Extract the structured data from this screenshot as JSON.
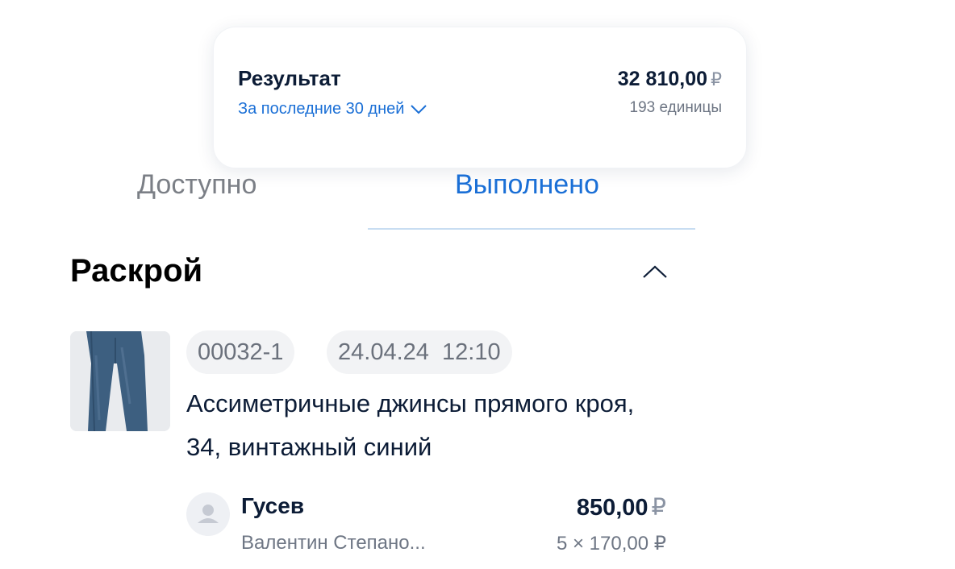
{
  "result": {
    "title": "Результат",
    "period": "За последние 30 дней",
    "amount": "32 810,00",
    "currency": "₽",
    "units": "193 единицы"
  },
  "tabs": [
    {
      "label": "Доступно",
      "active": false
    },
    {
      "label": "Выполнено",
      "active": true
    }
  ],
  "section": {
    "title": "Раскрой"
  },
  "order": {
    "id": "00032-1",
    "datetime": "24.04.24  12:10",
    "name": "Ассиметричные джинсы прямого кроя, 34, винтажный синий",
    "image_icon": "jeans-image",
    "worker_last_name": "Гусев",
    "worker_rest": "Валентин Степано...",
    "total": "850,00",
    "currency": "₽",
    "calc": "5 × 170,00 ₽"
  },
  "colors": {
    "accent": "#1a6fd6",
    "text": "#0c1c36",
    "muted": "#6e7684"
  }
}
